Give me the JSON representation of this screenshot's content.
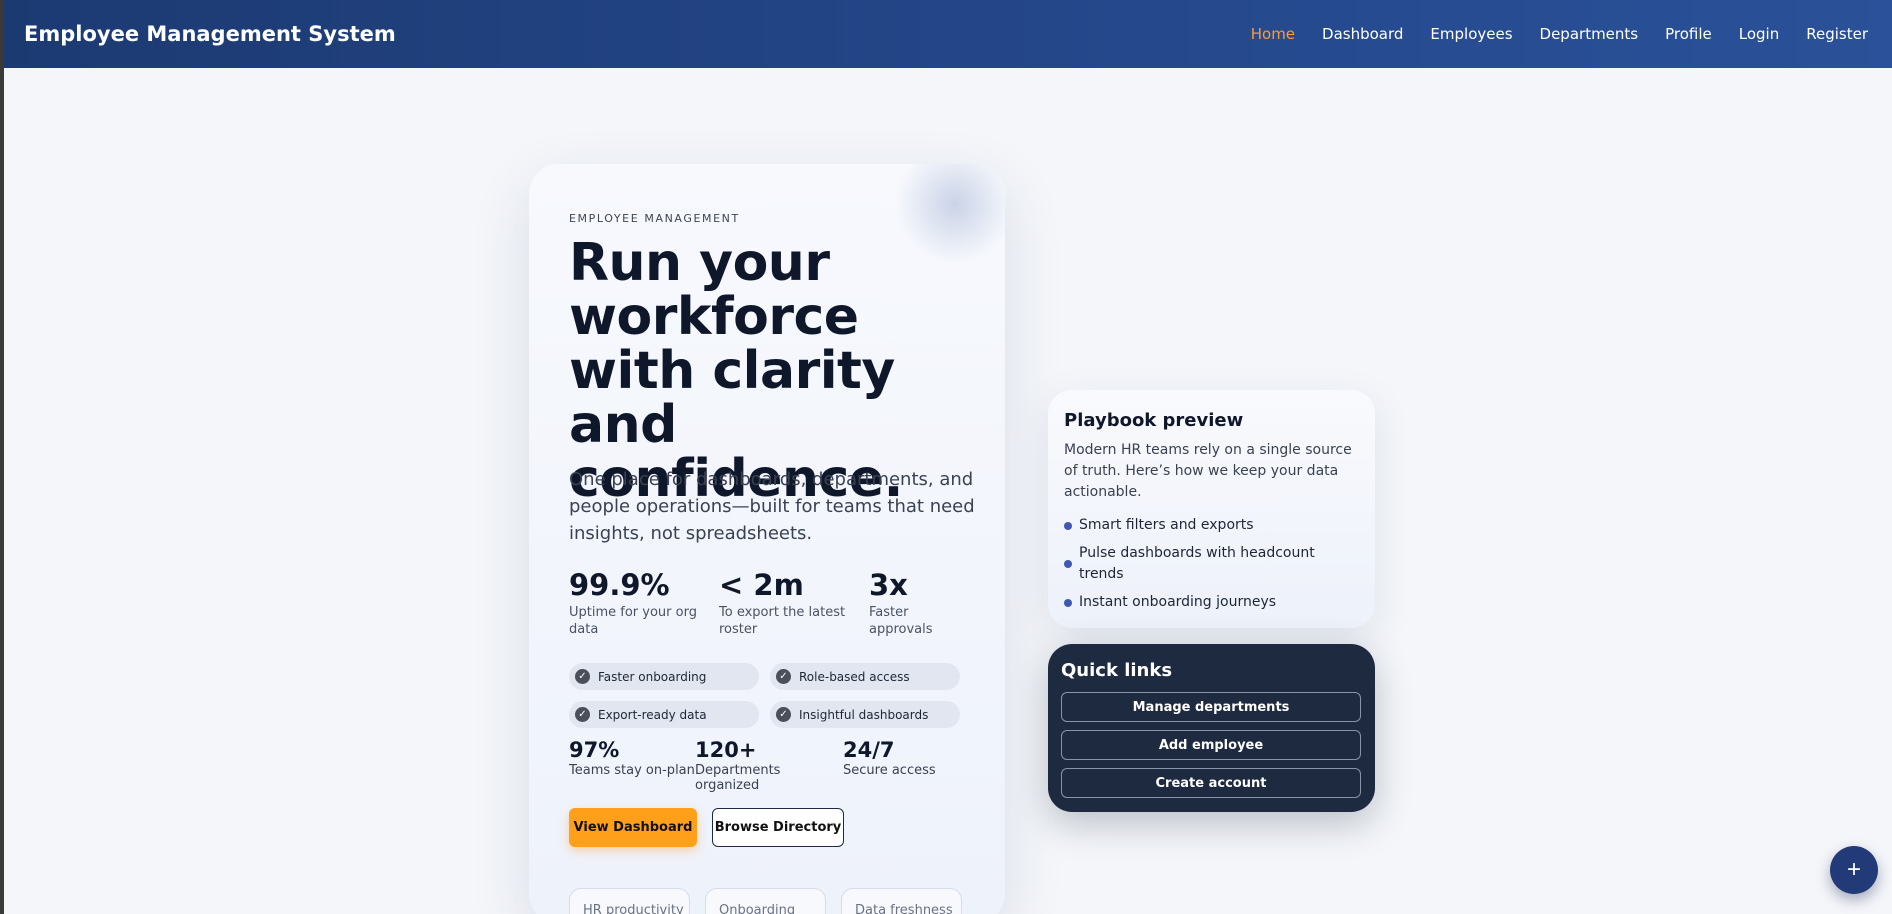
{
  "navbar": {
    "brand": "Employee Management System",
    "links": [
      "Home",
      "Dashboard",
      "Employees",
      "Departments",
      "Profile",
      "Login",
      "Register"
    ],
    "active": "Home",
    "active_color": "#ff9a2e"
  },
  "hero": {
    "eyebrow": "EMPLOYEE MANAGEMENT",
    "headline": "Run your workforce with clarity and confidence.",
    "lede": "One place for dashboards, departments, and people operations—built for teams that need insights, not spreadsheets.",
    "stats": [
      {
        "value": "99.9%",
        "label": "Uptime for your org data"
      },
      {
        "value": "< 2m",
        "label": "To export the latest roster"
      },
      {
        "value": "3x",
        "label": "Faster approvals"
      }
    ],
    "chips": [
      "Faster onboarding",
      "Role-based access",
      "Export-ready data",
      "Insightful dashboards"
    ],
    "metrics": [
      {
        "value": "97%",
        "label": "Teams stay on-plan"
      },
      {
        "value": "120+",
        "label": "Departments organized"
      },
      {
        "value": "24/7",
        "label": "Secure access"
      }
    ],
    "primary_button": "View Dashboard",
    "secondary_button": "Browse Directory",
    "mini_cards": [
      "HR productivity",
      "Onboarding",
      "Data freshness"
    ]
  },
  "playbook": {
    "title": "Playbook preview",
    "text": "Modern HR teams rely on a single source of truth. Here’s how we keep your data actionable.",
    "items": [
      "Smart filters and exports",
      "Pulse dashboards with headcount trends",
      "Instant onboarding journeys"
    ]
  },
  "quick_links": {
    "title": "Quick links",
    "buttons": [
      "Manage departments",
      "Add employee",
      "Create account"
    ]
  },
  "fab": {
    "icon": "plus-icon",
    "glyph": "+"
  },
  "colors": {
    "primary_accent": "#ff9f1a",
    "navbar": "#1c3a72",
    "dark_card": "#1e2a3f",
    "bullet": "#3f58b0"
  }
}
